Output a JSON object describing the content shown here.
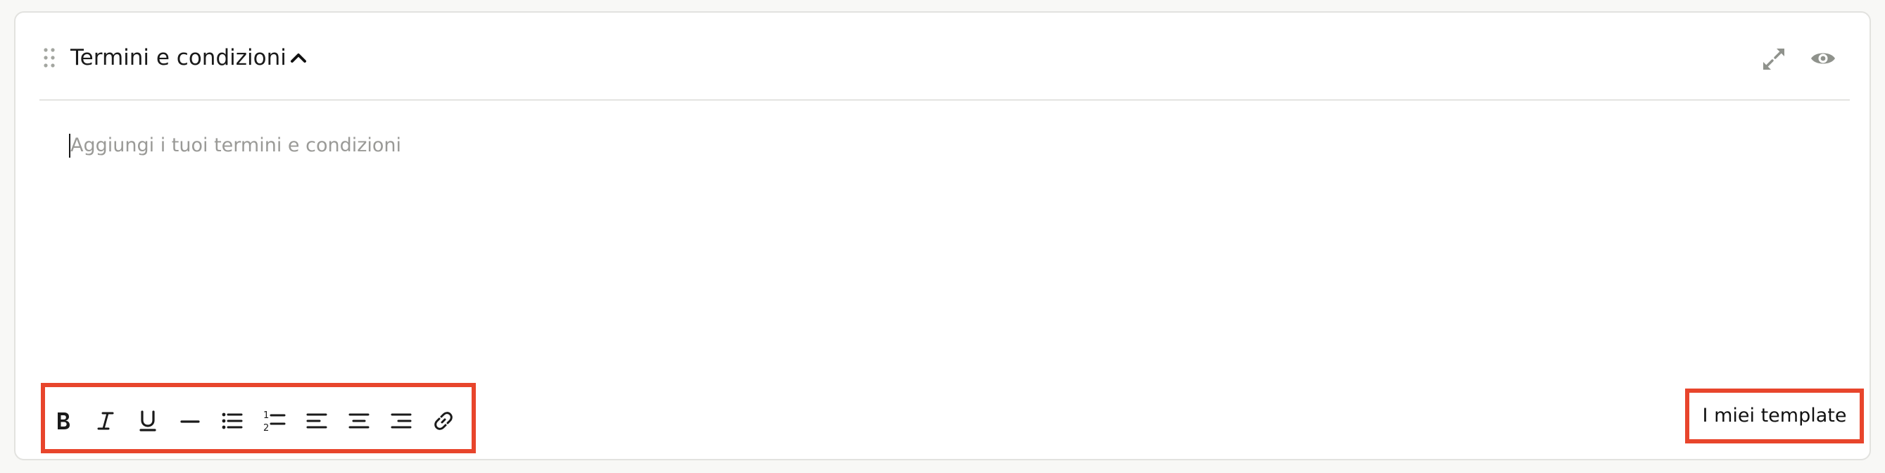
{
  "section": {
    "title": "Termini e condizioni",
    "icons": {
      "drag": "drag-handle-icon",
      "collapse": "chevron-up-icon",
      "expand": "expand-icon",
      "preview": "eye-icon"
    }
  },
  "editor": {
    "placeholder": "Aggiungi i tuoi termini e condizioni"
  },
  "toolbar": {
    "buttons": [
      {
        "icon": "bold-icon"
      },
      {
        "icon": "italic-icon"
      },
      {
        "icon": "underline-icon"
      },
      {
        "icon": "horizontal-rule-icon"
      },
      {
        "icon": "bullet-list-icon"
      },
      {
        "icon": "numbered-list-icon"
      },
      {
        "icon": "align-left-icon"
      },
      {
        "icon": "align-center-icon"
      },
      {
        "icon": "align-right-icon"
      },
      {
        "icon": "link-icon"
      }
    ]
  },
  "templates_button": {
    "label": "I miei template"
  },
  "colors": {
    "highlight": "#e8452c",
    "icon_muted": "#8f928c",
    "text": "#1a1a1a",
    "placeholder": "#9a9a97"
  }
}
